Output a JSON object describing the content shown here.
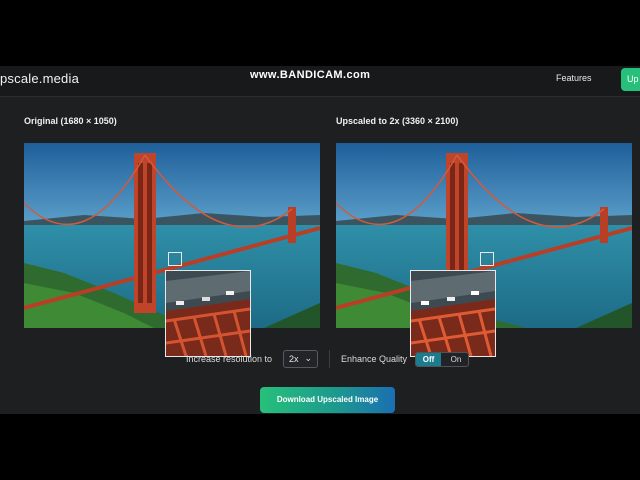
{
  "nav": {
    "logo": "pscale.media",
    "watermark": "www.BANDICAM.com",
    "features_link": "Features",
    "cta_label": "Up"
  },
  "original": {
    "title": "Original (1680 × 1050)"
  },
  "upscaled": {
    "title": "Upscaled to 2x (3360 × 2100)"
  },
  "controls": {
    "resolution_label": "Increase resolution to",
    "resolution_value": "2x",
    "enhance_label": "Enhance Quality",
    "toggle_off": "Off",
    "toggle_on": "On",
    "toggle_selected": "Off"
  },
  "download_label": "Download Upscaled Image",
  "colors": {
    "accent_green": "#27c07a",
    "accent_blue": "#1b6fb2",
    "bridge_red": "#c0442a",
    "app_background": "#1e1f21"
  }
}
